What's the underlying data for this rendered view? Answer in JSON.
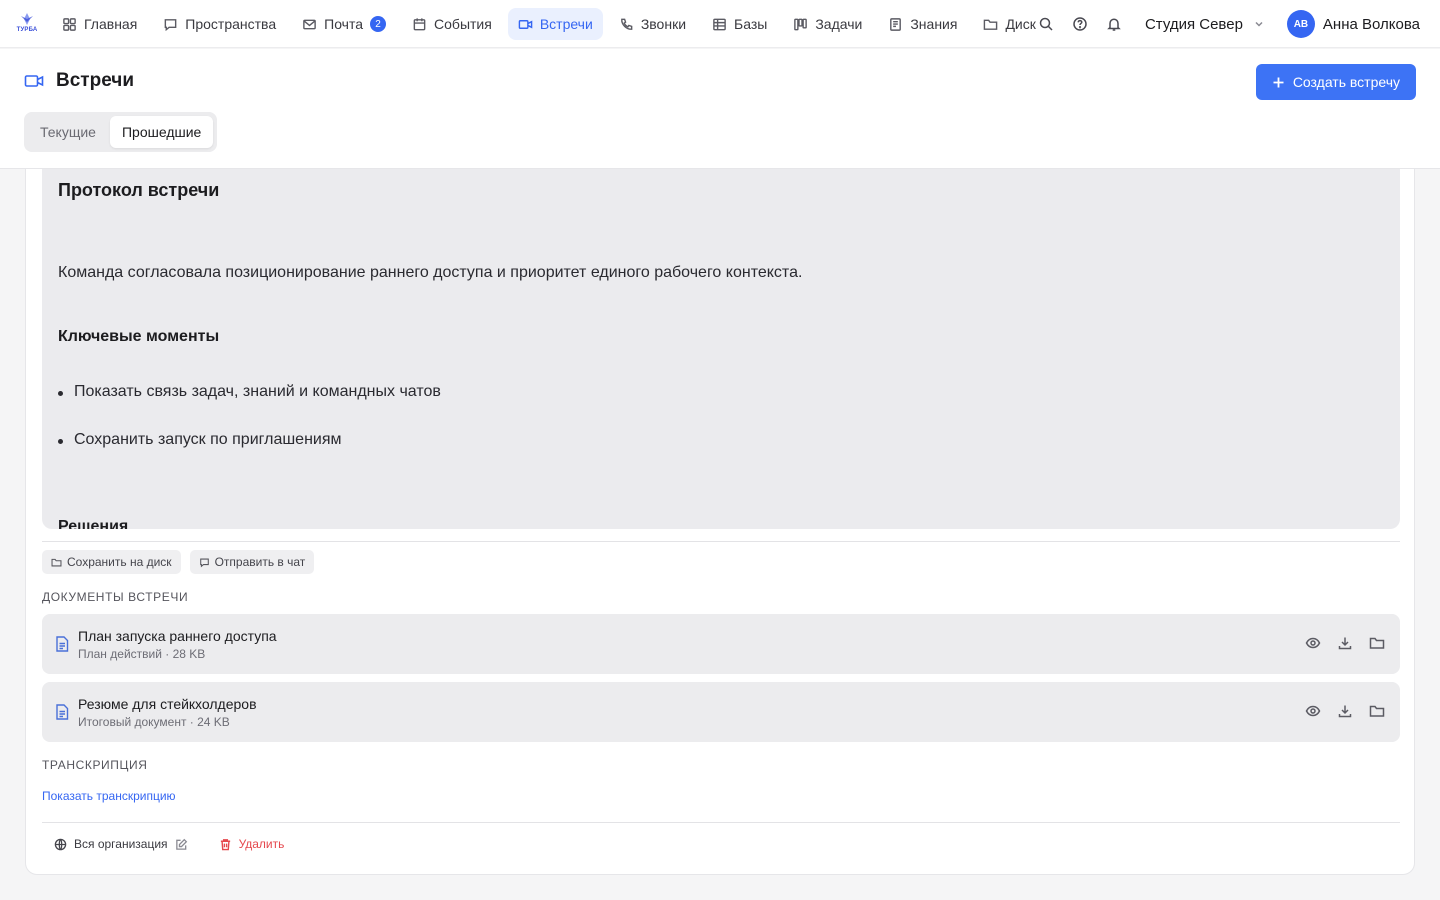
{
  "app": {
    "logo_text": "ТУРБА",
    "brand_color": "#3566f2"
  },
  "nav": {
    "items": [
      {
        "label": "Главная",
        "icon": "grid-icon"
      },
      {
        "label": "Пространства",
        "icon": "chat-bubble-icon"
      },
      {
        "label": "Почта",
        "icon": "mail-icon",
        "badge": "2"
      },
      {
        "label": "События",
        "icon": "calendar-icon"
      },
      {
        "label": "Встречи",
        "icon": "video-icon",
        "active": true
      },
      {
        "label": "Звонки",
        "icon": "phone-icon"
      },
      {
        "label": "Базы",
        "icon": "table-icon"
      },
      {
        "label": "Задачи",
        "icon": "kanban-icon"
      },
      {
        "label": "Знания",
        "icon": "book-icon"
      },
      {
        "label": "Диск",
        "icon": "folder-icon"
      }
    ]
  },
  "topbar": {
    "workspace": "Студия Север",
    "user_initials": "АВ",
    "user_name": "Анна Волкова"
  },
  "page": {
    "title": "Встречи",
    "create_button": "Создать встречу",
    "tabs": [
      {
        "label": "Текущие",
        "active": false
      },
      {
        "label": "Прошедшие",
        "active": true
      }
    ]
  },
  "protocol": {
    "heading": "Протокол встречи",
    "summary": "Команда согласовала позиционирование раннего доступа и приоритет единого рабочего контекста.",
    "key_points_heading": "Ключевые моменты",
    "key_points": [
      "Показать связь задач, знаний и командных чатов",
      "Сохранить запуск по приглашениям"
    ],
    "next_heading": "Решения"
  },
  "actions": {
    "save_to_disk": "Сохранить на диск",
    "send_to_chat": "Отправить в чат"
  },
  "documents": {
    "label": "ДОКУМЕНТЫ ВСТРЕЧИ",
    "items": [
      {
        "title": "План запуска раннего доступа",
        "meta": "План действий · 28 KB"
      },
      {
        "title": "Резюме для стейкхолдеров",
        "meta": "Итоговый документ · 24 KB"
      }
    ]
  },
  "transcript": {
    "label": "ТРАНСКРИПЦИЯ",
    "show_link": "Показать транскрипцию"
  },
  "footer": {
    "visibility": "Вся организация",
    "delete": "Удалить",
    "danger_color": "#e5484d"
  }
}
